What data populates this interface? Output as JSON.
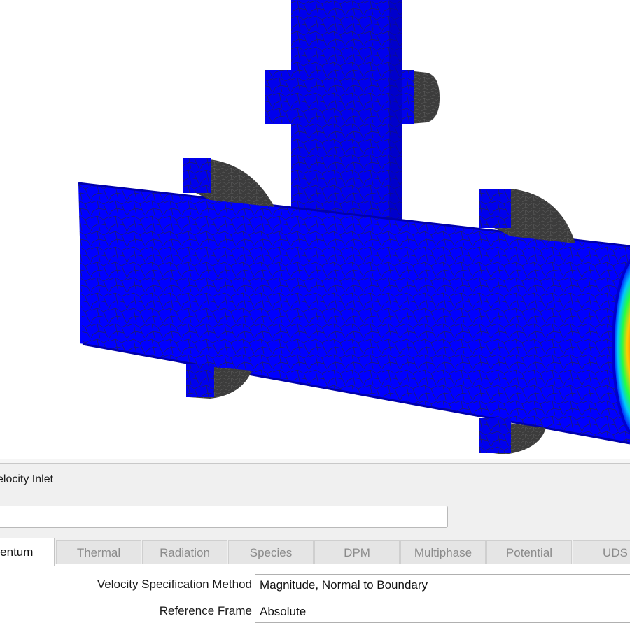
{
  "viewport": {
    "scene": "pipe-tee-velocity-contour",
    "colors": {
      "low": "#0000ff",
      "mid_low": "#00e0ff",
      "mid": "#22ff22",
      "mid_high": "#ffff00",
      "high": "#ff3300",
      "flange": "#3c3c3c",
      "mesh": "#1a1a1a"
    }
  },
  "dialog": {
    "title": "elocity Inlet",
    "zone_name_value": "",
    "tabs": [
      {
        "label": "mentum",
        "active": true
      },
      {
        "label": "Thermal",
        "active": false
      },
      {
        "label": "Radiation",
        "active": false
      },
      {
        "label": "Species",
        "active": false
      },
      {
        "label": "DPM",
        "active": false
      },
      {
        "label": "Multiphase",
        "active": false
      },
      {
        "label": "Potential",
        "active": false
      },
      {
        "label": "UDS",
        "active": false
      }
    ],
    "velocity_spec": {
      "label": "Velocity Specification Method",
      "value": "Magnitude, Normal to Boundary"
    },
    "reference_frame": {
      "label": "Reference Frame",
      "value": "Absolute"
    }
  }
}
